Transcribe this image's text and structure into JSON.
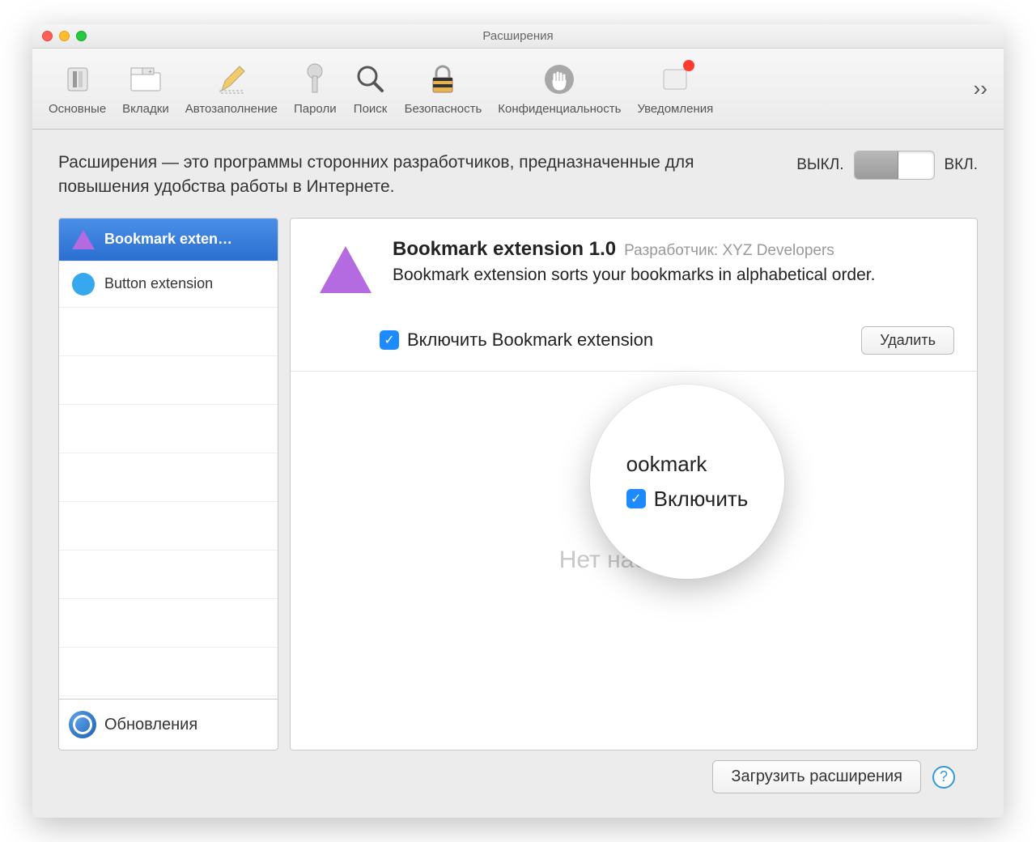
{
  "window": {
    "title": "Расширения"
  },
  "toolbar": {
    "items": [
      {
        "label": "Основные"
      },
      {
        "label": "Вкладки"
      },
      {
        "label": "Автозаполнение"
      },
      {
        "label": "Пароли"
      },
      {
        "label": "Поиск"
      },
      {
        "label": "Безопасность"
      },
      {
        "label": "Конфиденциальность"
      },
      {
        "label": "Уведомления"
      }
    ]
  },
  "intro": "Расширения — это программы сторонних разработчиков, предназначенные для повышения удобства работы в Интернете.",
  "toggle": {
    "off": "Выкл.",
    "on": "Вкл."
  },
  "sidebar": {
    "items": [
      {
        "label": "Bookmark exten…",
        "selected": true
      },
      {
        "label": "Button extension",
        "selected": false
      }
    ],
    "updates": "Обновления"
  },
  "extension": {
    "title": "Bookmark extension 1.0",
    "developer_prefix": "Разработчик:",
    "developer": "XYZ Developers",
    "description": "Bookmark extension sorts your bookmarks in alphabetical order.",
    "enable_label": "Включить Bookmark extension",
    "delete": "Удалить",
    "no_settings": "Нет настроек"
  },
  "callout": {
    "partial_top": "ookmark",
    "enable_short": "Включить"
  },
  "footer": {
    "load": "Загрузить расширения",
    "help": "?"
  }
}
